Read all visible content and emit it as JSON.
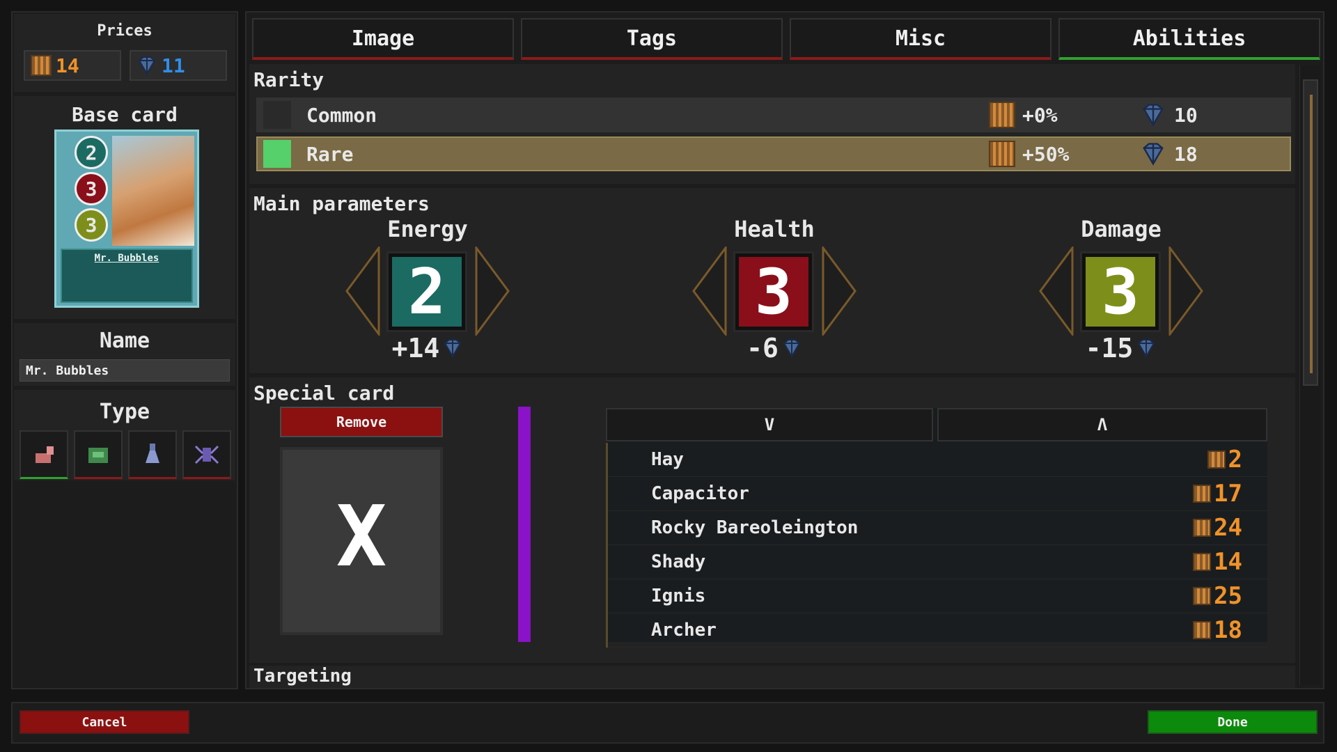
{
  "left": {
    "prices_title": "Prices",
    "coin_price": "14",
    "gem_price": "11",
    "base_card_title": "Base card",
    "card": {
      "energy": "2",
      "health": "3",
      "damage": "3",
      "name": "Mr. Bubbles"
    },
    "name_title": "Name",
    "name_value": "Mr. Bubbles",
    "type_title": "Type"
  },
  "tabs": [
    {
      "label": "Image"
    },
    {
      "label": "Tags"
    },
    {
      "label": "Misc"
    },
    {
      "label": "Abilities"
    }
  ],
  "rarity": {
    "title": "Rarity",
    "rows": [
      {
        "name": "Common",
        "coin_mod": "+0%",
        "gems": "10",
        "color": "#2a2a2a"
      },
      {
        "name": "Rare",
        "coin_mod": "+50%",
        "gems": "18",
        "color": "#55d06a"
      }
    ]
  },
  "main": {
    "title": "Main parameters",
    "energy": {
      "label": "Energy",
      "value": "2",
      "delta": "+14",
      "color": "#1b6b63"
    },
    "health": {
      "label": "Health",
      "value": "3",
      "delta": "-6",
      "color": "#8a0f1a"
    },
    "damage": {
      "label": "Damage",
      "value": "3",
      "delta": "-15",
      "color": "#7d8f1a"
    }
  },
  "special": {
    "title": "Special card",
    "remove_label": "Remove",
    "empty_symbol": "X",
    "sort_desc": "V",
    "sort_asc": "Λ",
    "items": [
      {
        "name": "Hay",
        "price": "2"
      },
      {
        "name": "Capacitor",
        "price": "17"
      },
      {
        "name": "Rocky Bareoleington",
        "price": "24"
      },
      {
        "name": "Shady",
        "price": "14"
      },
      {
        "name": "Ignis",
        "price": "25"
      },
      {
        "name": "Archer",
        "price": "18"
      }
    ]
  },
  "targeting_title": "Targeting",
  "footer": {
    "cancel_label": "Cancel",
    "done_label": "Done"
  },
  "colors": {
    "accent_orange": "#f0922a",
    "accent_blue": "#2f8fe8",
    "danger": "#8b1111",
    "success": "#0c8a0c",
    "rare_row": "#7a6a45"
  }
}
